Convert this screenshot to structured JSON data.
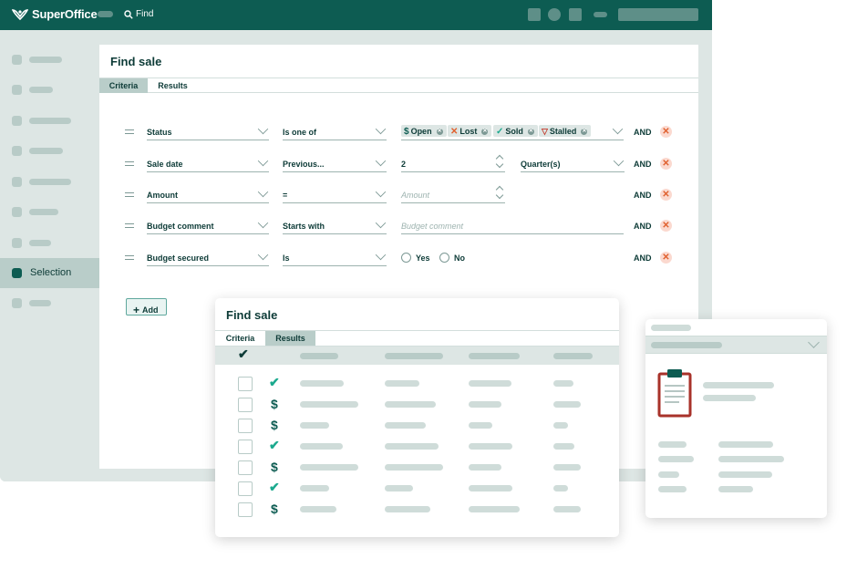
{
  "app": {
    "name": "SuperOffice",
    "find_label": "Find",
    "brand_color": "#0d5c52",
    "accent_color": "#1ba98e"
  },
  "sidebar": {
    "active_label": "Selection"
  },
  "panel": {
    "title": "Find sale",
    "tabs": [
      {
        "label": "Criteria",
        "active": true
      },
      {
        "label": "Results",
        "active": false
      }
    ],
    "add_label": "Add"
  },
  "criteria": [
    {
      "field": "Status",
      "operator": "Is one of",
      "chips": [
        {
          "icon": "dollar-icon",
          "label": "Open"
        },
        {
          "icon": "x-icon",
          "label": "Lost"
        },
        {
          "icon": "check-icon",
          "label": "Sold"
        },
        {
          "icon": "stalled-icon",
          "label": "Stalled"
        }
      ],
      "and": "AND"
    },
    {
      "field": "Sale date",
      "operator": "Previous...",
      "value": "2",
      "unit": "Quarter(s)",
      "and": "AND"
    },
    {
      "field": "Amount",
      "operator": "=",
      "placeholder": "Amount",
      "and": "AND"
    },
    {
      "field": "Budget comment",
      "operator": "Starts with",
      "placeholder": "Budget comment",
      "and": "AND"
    },
    {
      "field": "Budget secured",
      "operator": "Is",
      "options": [
        "Yes",
        "No"
      ],
      "and": "AND"
    }
  ],
  "results_card": {
    "title": "Find sale",
    "tabs": [
      {
        "label": "Criteria",
        "active": false
      },
      {
        "label": "Results",
        "active": true
      }
    ],
    "rows": [
      {
        "status": "check-icon"
      },
      {
        "status": "dollar-icon"
      },
      {
        "status": "dollar-icon"
      },
      {
        "status": "check-icon"
      },
      {
        "status": "dollar-icon"
      },
      {
        "status": "check-icon"
      },
      {
        "status": "dollar-icon"
      }
    ]
  },
  "detail_card": {
    "icon": "clipboard-icon"
  }
}
